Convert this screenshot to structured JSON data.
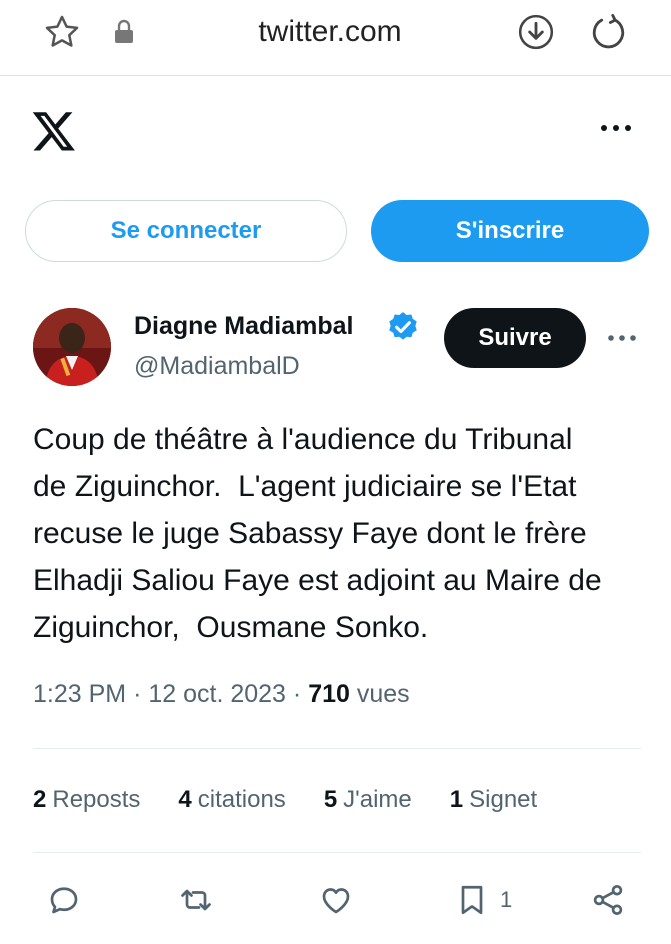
{
  "browser": {
    "url": "twitter.com",
    "icons": [
      "star-icon",
      "lock-icon",
      "download-icon",
      "reload-icon"
    ]
  },
  "header": {
    "logo": "x-logo",
    "more_icon": "more-icon"
  },
  "auth": {
    "login_label": "Se connecter",
    "signup_label": "S'inscrire"
  },
  "tweet": {
    "author_name": "Diagne Madiambal",
    "handle": "@MadiambalD",
    "follow_label": "Suivre",
    "text": "Coup de théâtre à l'audience du Tribunal\nde Ziguinchor.  L'agent judiciaire se l'Etat\nrecuse le juge Sabassy Faye dont le frère\nElhadji Saliou Faye est adjoint au Maire de\nZiguinchor,  Ousmane Sonko.",
    "time": "1:23 PM",
    "date": "12 oct. 2023",
    "views_count": "710",
    "views_label": "vues",
    "separator": "·"
  },
  "stats": {
    "reposts_count": "2",
    "reposts_label": "Reposts",
    "quotes_count": "4",
    "quotes_label": "citations",
    "likes_count": "5",
    "likes_label": "J'aime",
    "bookmarks_count": "1",
    "bookmarks_label": "Signet"
  },
  "actions": {
    "bookmark_count": "1"
  },
  "colors": {
    "accent": "#1d9bf0",
    "text": "#0f1419",
    "secondary": "#536471",
    "follow_bg": "#0f1419"
  }
}
